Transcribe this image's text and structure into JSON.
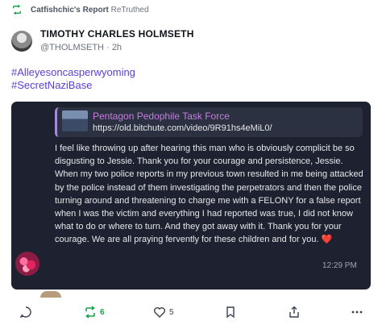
{
  "retruth_banner": {
    "text": "Catfishchic's Report",
    "suffix": "ReTruthed"
  },
  "author": {
    "name": "TIMOTHY CHARLES HOLMSETH",
    "handle": "@THOLMSETH",
    "separator": "·",
    "time": "2h"
  },
  "hashtags": [
    "#Alleyesoncasperwyoming",
    "#SecretNaziBase"
  ],
  "link_preview": {
    "title": "Pentagon Pedophile Task Force",
    "url": "https://old.bitchute.com/video/9R91hs4eMiL0/"
  },
  "message": {
    "text": "I feel like throwing up after hearing this man who is obviously complicit be so disgusting to Jessie. Thank you for your courage and persistence, Jessie. When my two police reports in my previous town resulted in me being attacked by the police instead of them investigating the perpetrators and then the police turning around and  threatening to charge me with a FELONY for a false report when I was the victim and everything I had reported was true, I did not know what to do or where to turn. And they got away with it. Thank you for your courage. We are all praying fervently for these children and for you.",
    "emoji": "❤️",
    "time": "12:29 PM"
  },
  "actions": {
    "reply_count": "",
    "retruth_count": "6",
    "like_count": "5"
  },
  "colors": {
    "accent": "#5b3fd4",
    "retruth_green": "#16a34a",
    "card_bg": "#1e2230"
  }
}
